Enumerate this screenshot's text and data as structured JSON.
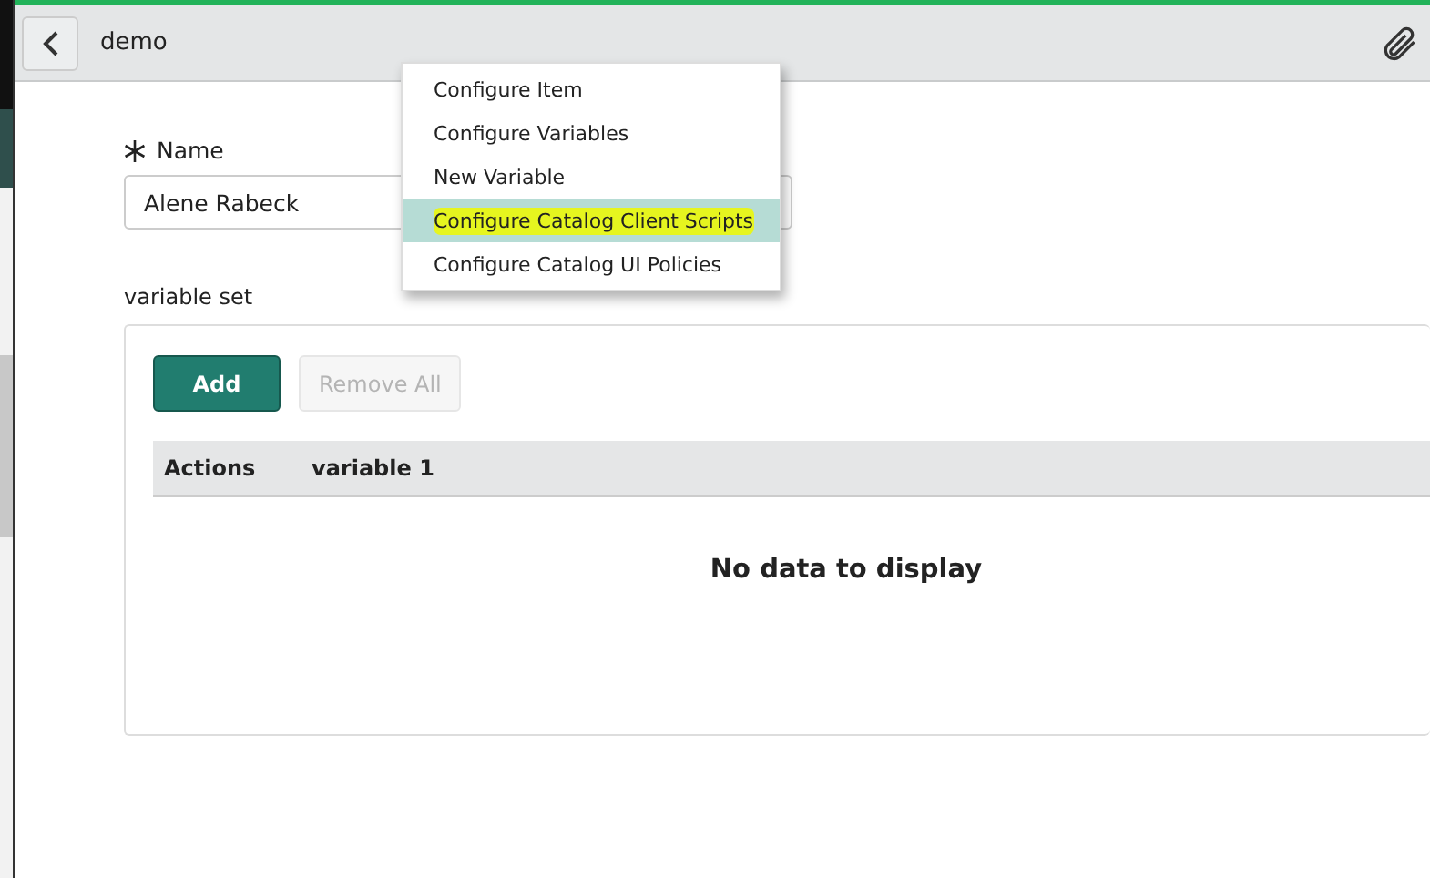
{
  "header": {
    "title": "demo"
  },
  "form": {
    "name_field": {
      "label": "Name",
      "required": true,
      "value": "Alene Rabeck"
    },
    "variable_set": {
      "label": "variable set",
      "buttons": [
        {
          "label": "Add",
          "kind": "primary",
          "disabled": false
        },
        {
          "label": "Remove All",
          "kind": "secondary",
          "disabled": true
        }
      ],
      "table": {
        "columns": [
          "Actions",
          "variable 1"
        ],
        "empty_message": "No data to display"
      }
    }
  },
  "context_menu": {
    "items": [
      {
        "label": "Configure Item",
        "selected": false,
        "marked": false
      },
      {
        "label": "Configure Variables",
        "selected": false,
        "marked": false
      },
      {
        "label": "New Variable",
        "selected": false,
        "marked": false
      },
      {
        "label": "Configure Catalog Client Scripts",
        "selected": true,
        "marked": true
      },
      {
        "label": "Configure Catalog UI Policies",
        "selected": false,
        "marked": false
      }
    ]
  }
}
